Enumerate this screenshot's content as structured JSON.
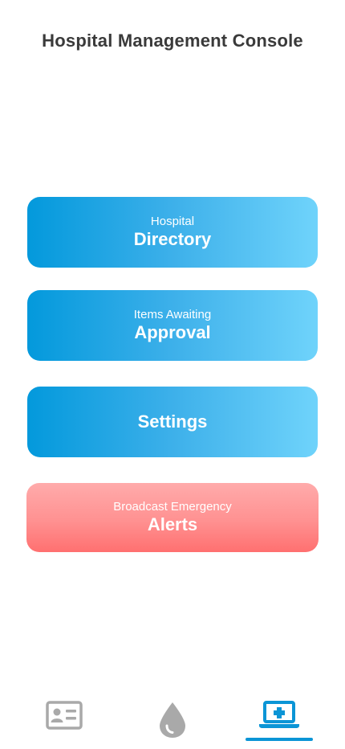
{
  "header": {
    "title": "Hospital Management Console"
  },
  "menu": {
    "directory": {
      "sub": "Hospital",
      "main": "Directory"
    },
    "approval": {
      "sub": "Items Awaiting",
      "main": "Approval"
    },
    "settings": {
      "main": "Settings"
    },
    "alerts": {
      "sub": "Broadcast Emergency",
      "main": "Alerts"
    }
  },
  "tabs": [
    {
      "icon": "id-card-icon",
      "active": false
    },
    {
      "icon": "blood-drop-icon",
      "active": false
    },
    {
      "icon": "laptop-medical-icon",
      "active": true
    }
  ],
  "colors": {
    "primary_blue": "#0399dc",
    "light_blue": "#6fd3fb",
    "alert_red": "#ff7070",
    "alert_pink": "#ffabab",
    "inactive_icon": "#a9a9a9",
    "active_icon": "#0b95d6"
  }
}
